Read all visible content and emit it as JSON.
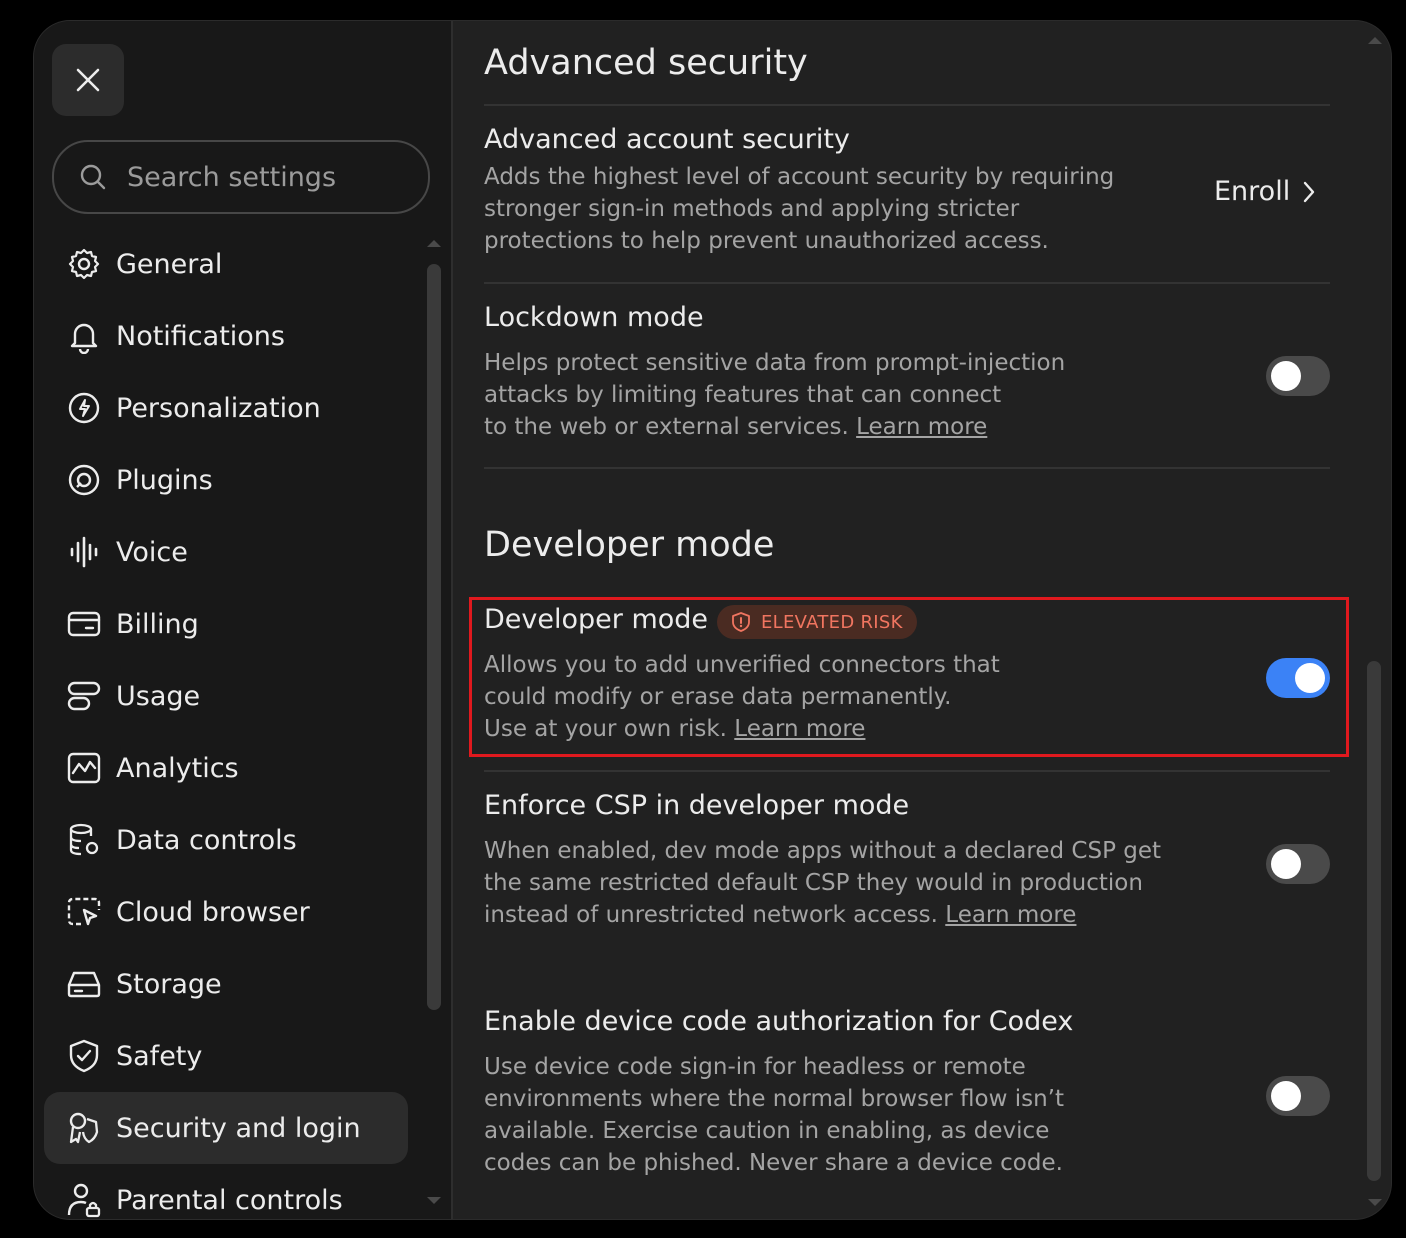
{
  "search": {
    "placeholder": "Search settings"
  },
  "sidebar": {
    "items": [
      {
        "label": "General",
        "icon": "gear-icon"
      },
      {
        "label": "Notifications",
        "icon": "bell-icon"
      },
      {
        "label": "Personalization",
        "icon": "personalization-icon"
      },
      {
        "label": "Plugins",
        "icon": "plugins-icon"
      },
      {
        "label": "Voice",
        "icon": "voice-wave-icon"
      },
      {
        "label": "Billing",
        "icon": "credit-card-icon"
      },
      {
        "label": "Usage",
        "icon": "usage-icon"
      },
      {
        "label": "Analytics",
        "icon": "analytics-chart-icon"
      },
      {
        "label": "Data controls",
        "icon": "database-gear-icon"
      },
      {
        "label": "Cloud browser",
        "icon": "cloud-browser-icon"
      },
      {
        "label": "Storage",
        "icon": "storage-drive-icon"
      },
      {
        "label": "Safety",
        "icon": "shield-check-icon"
      },
      {
        "label": "Security and login",
        "icon": "security-key-icon"
      },
      {
        "label": "Parental controls",
        "icon": "parental-lock-icon"
      }
    ],
    "active_index": 12
  },
  "main": {
    "advanced_security": {
      "title": "Advanced security",
      "account_security": {
        "title": "Advanced account security",
        "desc_lines": [
          "Adds the highest level of account security by requiring",
          "stronger sign-in methods and applying stricter",
          "protections to help prevent unauthorized access."
        ],
        "action_label": "Enroll"
      },
      "lockdown": {
        "title": "Lockdown mode",
        "desc_lines": [
          "Helps protect sensitive data from prompt-injection",
          "attacks by limiting features that can connect",
          "to the web or external services."
        ],
        "learn_more": "Learn more",
        "enabled": false
      }
    },
    "developer_mode": {
      "title": "Developer mode",
      "toggle_row": {
        "title": "Developer mode",
        "badge": "ELEVATED RISK",
        "desc_lines": [
          "Allows you to add unverified connectors that",
          "could modify or erase data permanently.",
          "Use at your own risk."
        ],
        "learn_more": "Learn more",
        "enabled": true
      },
      "csp": {
        "title": "Enforce CSP in developer mode",
        "desc_lines": [
          "When enabled, dev mode apps without a declared CSP get",
          "the same restricted default CSP they would in production",
          "instead of unrestricted network access."
        ],
        "learn_more": "Learn more",
        "enabled": false
      },
      "device_code": {
        "title": "Enable device code authorization for Codex",
        "desc_lines": [
          "Use device code sign-in for headless or remote",
          "environments where the normal browser flow isn’t",
          "available. Exercise caution in enabling, as device",
          "codes can be phished. Never share a device code."
        ],
        "enabled": false
      }
    }
  },
  "colors": {
    "background": "#212121",
    "sidebar": "#181818",
    "text": "#ececec",
    "muted_text": "#a4a4a4",
    "toggle_on": "#3b82f6",
    "toggle_off": "#4a4a4a",
    "risk_badge_bg": "#4a2b22",
    "risk_badge_text": "#f07560",
    "highlight_border": "#e0191e"
  }
}
